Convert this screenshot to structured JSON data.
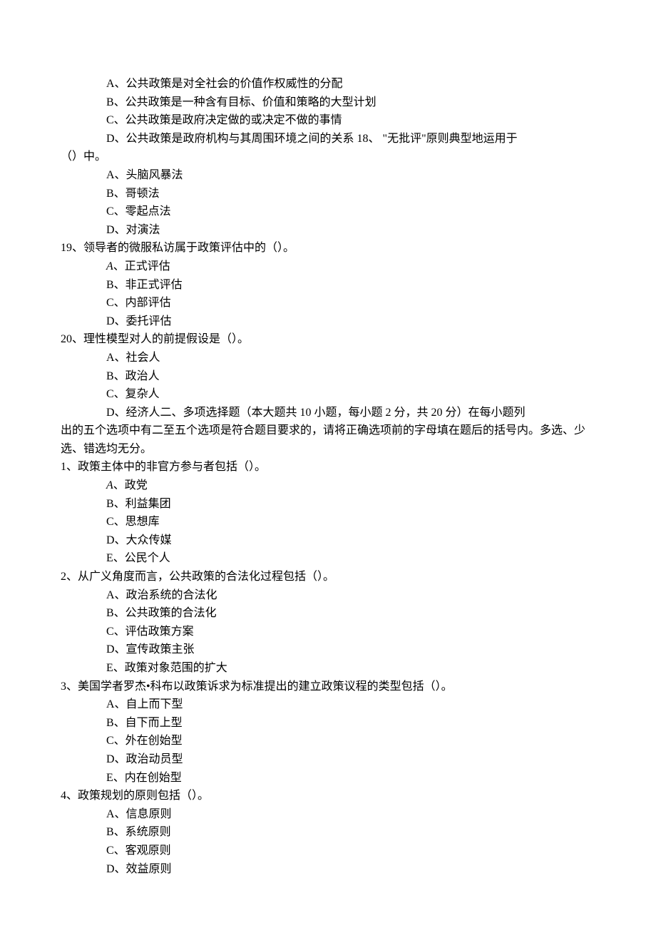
{
  "lines": [
    {
      "cls": "indent-1",
      "text": "A、公共政策是对全社会的价值作权威性的分配"
    },
    {
      "cls": "indent-1",
      "text": "B、公共政策是一种含有目标、价值和策略的大型计划"
    },
    {
      "cls": "indent-1",
      "text": "C、公共政策是政府决定做的或决定不做的事情"
    },
    {
      "cls": "indent-1",
      "text": "D、公共政策是政府机构与其周围环境之间的关系 18、 \"无批评\"原则典型地运用于"
    },
    {
      "cls": "no-indent",
      "text": "（）中。"
    },
    {
      "cls": "indent-1",
      "text": "A、头脑风暴法"
    },
    {
      "cls": "indent-1",
      "text": "B、哥顿法"
    },
    {
      "cls": "indent-1",
      "text": "C、零起点法"
    },
    {
      "cls": "indent-1",
      "text": "D、对演法"
    },
    {
      "cls": "q-line",
      "text": "19、领导者的微服私访属于政策评估中的（）。"
    },
    {
      "cls": "indent-italic",
      "html": "<span class='letter'>A</span>、正式评估"
    },
    {
      "cls": "indent-1",
      "text": "B、非正式评估"
    },
    {
      "cls": "indent-1",
      "text": "C、内部评估"
    },
    {
      "cls": "indent-1",
      "text": "D、委托评估"
    },
    {
      "cls": "q-line",
      "text": "20、理性模型对人的前提假设是（）。"
    },
    {
      "cls": "indent-1",
      "text": "A、社会人"
    },
    {
      "cls": "indent-1",
      "text": "B、政治人"
    },
    {
      "cls": "indent-1",
      "text": "C、复杂人"
    },
    {
      "cls": "indent-1",
      "text": "D、经济人二、多项选择题（本大题共 10 小题，每小题 2 分，共 20 分）在每小题列"
    },
    {
      "cls": "no-indent",
      "text": "出的五个选项中有二至五个选项是符合题目要求的，请将正确选项前的字母填在题后的括号内。多选、少选、错选均无分。"
    },
    {
      "cls": "q-line",
      "text": "1、政策主体中的非官方参与者包括（）。"
    },
    {
      "cls": "indent-italic",
      "html": "<span class='letter'>A</span>、政党"
    },
    {
      "cls": "indent-1",
      "text": "B、利益集团"
    },
    {
      "cls": "indent-1",
      "text": "C、思想库"
    },
    {
      "cls": "indent-1",
      "text": "D、大众传媒"
    },
    {
      "cls": "indent-1",
      "text": "E、公民个人"
    },
    {
      "cls": "q-line",
      "text": "2、从广义角度而言，公共政策的合法化过程包括（）。"
    },
    {
      "cls": "indent-1",
      "text": "A、政治系统的合法化"
    },
    {
      "cls": "indent-1",
      "text": "B、公共政策的合法化"
    },
    {
      "cls": "indent-1",
      "text": "C、评估政策方案"
    },
    {
      "cls": "indent-1",
      "text": "D、宣传政策主张"
    },
    {
      "cls": "indent-1",
      "text": "E、政策对象范围的扩大"
    },
    {
      "cls": "q-line",
      "text": "3、美国学者罗杰•科布以政策诉求为标准提出的建立政策议程的类型包括（）。"
    },
    {
      "cls": "indent-1",
      "text": "A、自上而下型"
    },
    {
      "cls": "indent-1",
      "text": "B、自下而上型"
    },
    {
      "cls": "indent-1",
      "text": "C、外在创始型"
    },
    {
      "cls": "indent-1",
      "text": "D、政治动员型"
    },
    {
      "cls": "indent-1",
      "text": "E、内在创始型"
    },
    {
      "cls": "q-line",
      "text": "4、政策规划的原则包括（）。"
    },
    {
      "cls": "indent-1",
      "text": "A、信息原则"
    },
    {
      "cls": "indent-1",
      "text": "B、系统原则"
    },
    {
      "cls": "indent-1",
      "text": "C、客观原则"
    },
    {
      "cls": "indent-1",
      "text": "D、效益原则"
    }
  ]
}
